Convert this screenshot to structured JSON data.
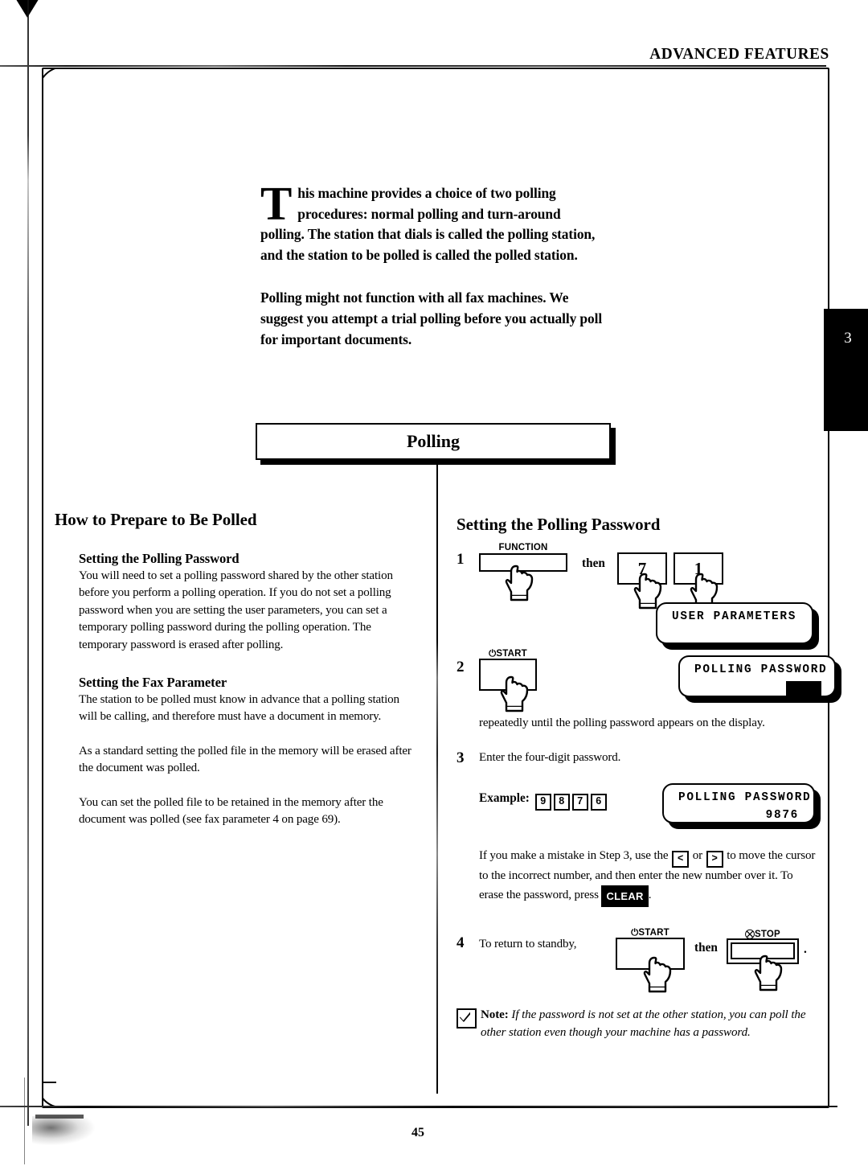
{
  "header": {
    "title": "ADVANCED FEATURES"
  },
  "chapter_tab": {
    "number": "3"
  },
  "intro": {
    "dropcap": "T",
    "paragraph1": "his machine provides a choice of two polling procedures: normal polling and turn-around polling. The station that dials is called the polling station, and the station to be polled is called the polled station.",
    "paragraph2": "Polling might not function with all fax machines. We suggest you attempt a trial polling before you actually poll for important documents."
  },
  "section_title": {
    "label": "Polling"
  },
  "left_column": {
    "heading": "How to Prepare to Be Polled",
    "sections": [
      {
        "subheading": "Setting the Polling Password",
        "paragraphs": [
          "You will need to set a polling password shared by the other station before you perform a polling operation. If you do not set a polling password when you are setting the user parameters, you can set a temporary polling password during the polling operation.  The temporary password is erased after polling."
        ]
      },
      {
        "subheading": "Setting the Fax Parameter",
        "paragraphs": [
          "The station to be polled must know in advance that a polling station will be calling, and therefore must have a document in memory.",
          "As a standard setting the polled file in the memory will be erased after the document was polled.",
          "You can set the polled file to be retained in the memory after the document was polled (see fax parameter 4 on page 69)."
        ]
      }
    ]
  },
  "right_column": {
    "heading": "Setting the Polling Password",
    "steps": [
      {
        "number": "1",
        "keys": [
          {
            "label": "FUNCTION",
            "type": "wide"
          },
          {
            "connector": "then"
          },
          {
            "label": "7",
            "type": "square"
          },
          {
            "label": "1",
            "type": "square"
          }
        ],
        "display": {
          "line1": "USER PARAMETERS",
          "line2": ""
        }
      },
      {
        "number": "2",
        "keys": [
          {
            "label": "START",
            "icon": "power-icon",
            "type": "square"
          }
        ],
        "display": {
          "line1": "POLLING PASSWORD",
          "line2": "",
          "cursor": true
        },
        "text": "repeatedly until the polling password appears on the display."
      },
      {
        "number": "3",
        "text": "Enter the four-digit password.",
        "example_label": "Example:",
        "example_digits": [
          "9",
          "8",
          "7",
          "6"
        ],
        "display": {
          "line1": "POLLING PASSWORD",
          "line2": "9876"
        },
        "followup_parts": {
          "a": "If you make a mistake in Step 3, use the",
          "key_left": "<",
          "b": "or",
          "key_right": ">",
          "c": "to move the cursor to the incorrect number, and then enter the new number over it.  To erase the password, press",
          "clear_key": "CLEAR",
          "d": "."
        }
      },
      {
        "number": "4",
        "text": "To return to standby,",
        "keys": [
          {
            "label": "START",
            "icon": "power-icon",
            "type": "square"
          },
          {
            "connector": "then"
          },
          {
            "label": "STOP",
            "icon": "stop-icon",
            "type": "stop"
          }
        ],
        "trailing": "."
      }
    ],
    "note": {
      "icon": "checkmark-icon",
      "label": "Note:",
      "text": "If the password is not set at the other station, you can poll the other station even though your machine has a password."
    }
  },
  "footer": {
    "page_number": "45"
  }
}
